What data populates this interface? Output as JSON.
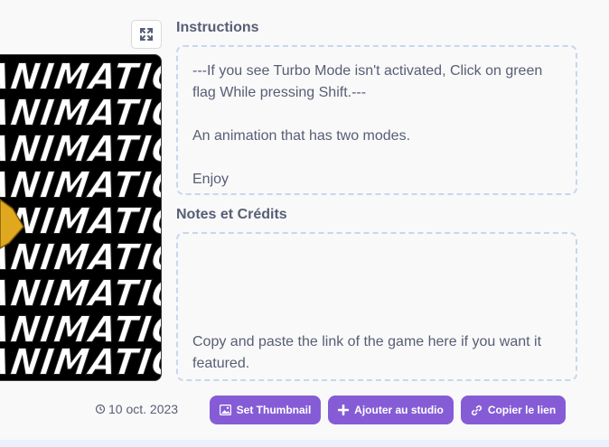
{
  "stage": {
    "rows": [
      "ANIMATION",
      "ANIMATION",
      "ANIMATION",
      "ANIMATION",
      "ANIMATION",
      "ANIMATION",
      "ANIMATION",
      "ANIMATION",
      "ANIMATION"
    ],
    "background_color": "#000000",
    "text_color": "#ffffff",
    "sprite_color": "#e0a81e"
  },
  "fullscreen": {
    "icon": "fullscreen-icon"
  },
  "instructions": {
    "title": "Instructions",
    "text": "---If you see Turbo Mode isn't activated, Click on green flag While pressing Shift.---\n\nAn animation that has two modes.\n\nEnjoy"
  },
  "notes": {
    "title": "Notes et Crédits",
    "text": "Copy and paste the link of the game here if you want it featured."
  },
  "footer": {
    "date_icon": "clock-icon",
    "date": "10 oct. 2023",
    "buttons": {
      "thumbnail": {
        "label": "Set Thumbnail",
        "icon": "image-icon"
      },
      "studio": {
        "label": "Ajouter au studio",
        "icon": "plus-icon"
      },
      "copy_link": {
        "label": "Copier le lien",
        "icon": "link-icon"
      }
    }
  },
  "colors": {
    "accent": "#855cd6",
    "text": "#575e75",
    "dashed_border": "#c8d6ef",
    "page_background": "#f9f9f9"
  }
}
